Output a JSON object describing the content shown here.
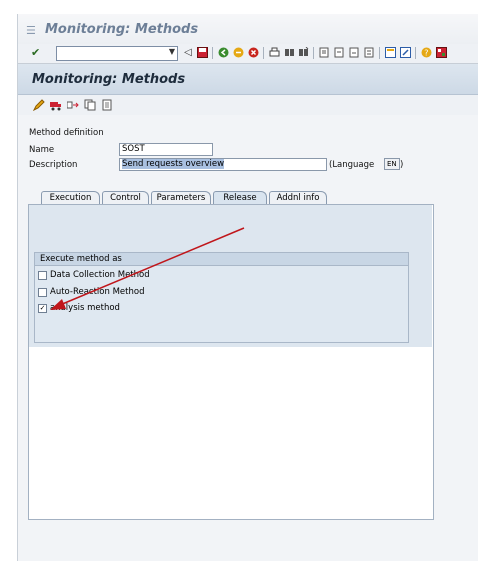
{
  "window": {
    "title": "Monitoring: Methods"
  },
  "system_toolbar": {
    "command_field_value": ""
  },
  "screen": {
    "title": "Monitoring: Methods"
  },
  "method_definition": {
    "section_label": "Method definition",
    "name_label": "Name",
    "name_value": "SOST",
    "description_label": "Description",
    "description_value": "Send requests overview",
    "language_label": "(Language",
    "language_value": "EN",
    "language_close": ")"
  },
  "tabs": [
    {
      "label": "Execution",
      "active": false
    },
    {
      "label": "Control",
      "active": false
    },
    {
      "label": "Parameters",
      "active": false
    },
    {
      "label": "Release",
      "active": true
    },
    {
      "label": "Addnl info",
      "active": false
    }
  ],
  "execute_group": {
    "title": "Execute method as",
    "options": [
      {
        "label": "Data Collection Method",
        "checked": false
      },
      {
        "label": "Auto-Reaction Method",
        "checked": false
      },
      {
        "label": "analysis method",
        "checked": true
      }
    ]
  },
  "colors": {
    "arrow": "#c0161b",
    "title_text": "#6d7f97"
  },
  "icons": {
    "system_toolbar": [
      "enter-icon",
      "back-icon",
      "save-icon",
      "back-green-icon",
      "exit-icon",
      "cancel-icon",
      "print-icon",
      "find-icon",
      "find-next-icon",
      "first-page-icon",
      "previous-page-icon",
      "next-page-icon",
      "last-page-icon",
      "new-session-icon",
      "shortcut-icon",
      "help-icon",
      "layout-icon"
    ],
    "application_toolbar": [
      "edit-pencil-icon",
      "transport-icon",
      "move-icon",
      "copy-icon",
      "document-icon"
    ]
  }
}
